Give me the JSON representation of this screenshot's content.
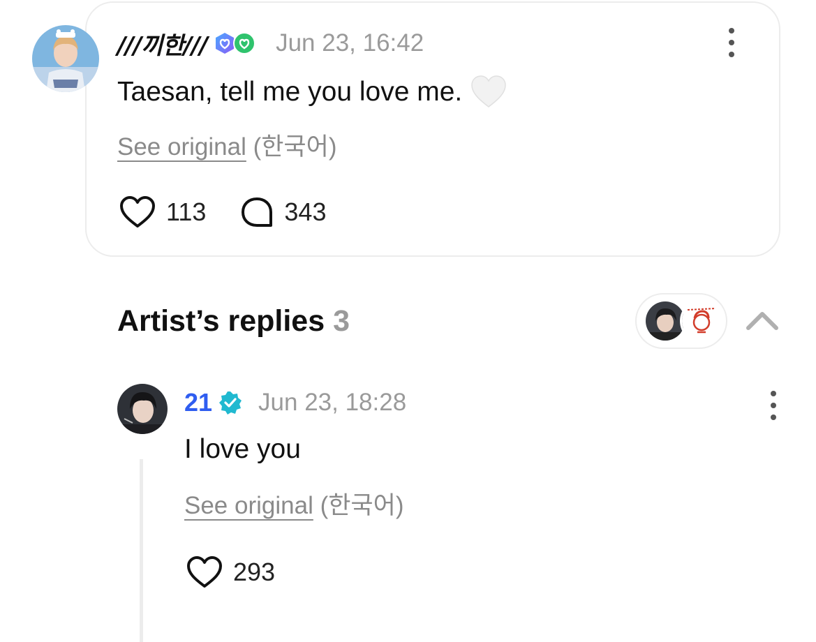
{
  "post": {
    "author": "///끼한///",
    "timestamp": "Jun 23, 16:42",
    "text": "Taesan, tell me you love me.",
    "emoji": "white-heart",
    "see_original": "See original",
    "language": "(한국어)",
    "likes": "113",
    "comments": "343"
  },
  "replies_section": {
    "title": "Artist’s replies",
    "count": "3"
  },
  "reply": {
    "author": "21",
    "timestamp": "Jun 23, 18:28",
    "text": "I love you",
    "see_original": "See original",
    "language": "(한국어)",
    "likes": "293"
  },
  "colors": {
    "accent_blue": "#2f5df0",
    "verified_teal": "#20b9d0",
    "badge_green": "#2fc36d",
    "muted": "#9a9a9a"
  }
}
